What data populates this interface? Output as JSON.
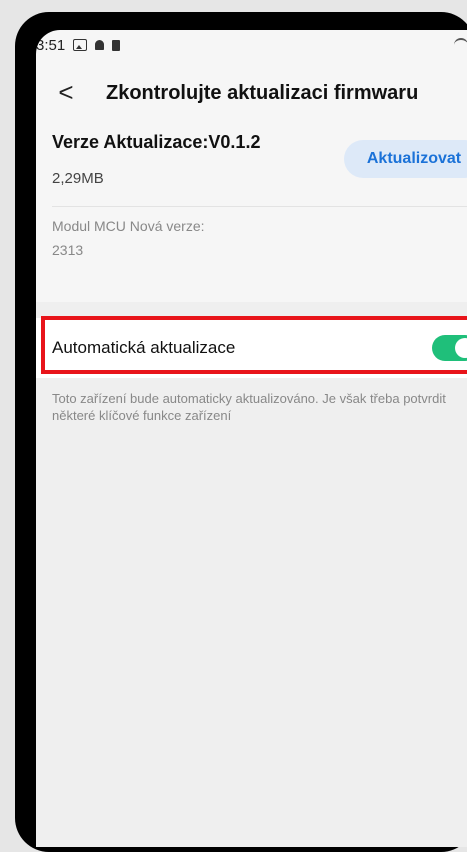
{
  "status_bar": {
    "time": "3:51",
    "icons": [
      "image-icon",
      "bell-icon",
      "battery-icon",
      "wifi-icon",
      "signal-icon"
    ]
  },
  "header": {
    "back_icon": "chevron-left-icon",
    "back_glyph": "<",
    "title": "Zkontrolujte aktualizaci firmwaru"
  },
  "update": {
    "version_label": "Verze Aktualizace:V0.1.2",
    "size": "2,29MB",
    "button_label": "Aktualizovat",
    "button_color": "#1b72d8"
  },
  "mcu": {
    "label": "Modul MCU Nová verze:",
    "value": "2313"
  },
  "auto_update": {
    "label": "Automatická aktualizace",
    "enabled": true,
    "toggle_color": "#1fbf7a",
    "description": "Toto zařízení bude automaticky aktualizováno. Je však třeba potvrdit některé klíčové funkce zařízení"
  },
  "highlight_color": "#e8141a"
}
